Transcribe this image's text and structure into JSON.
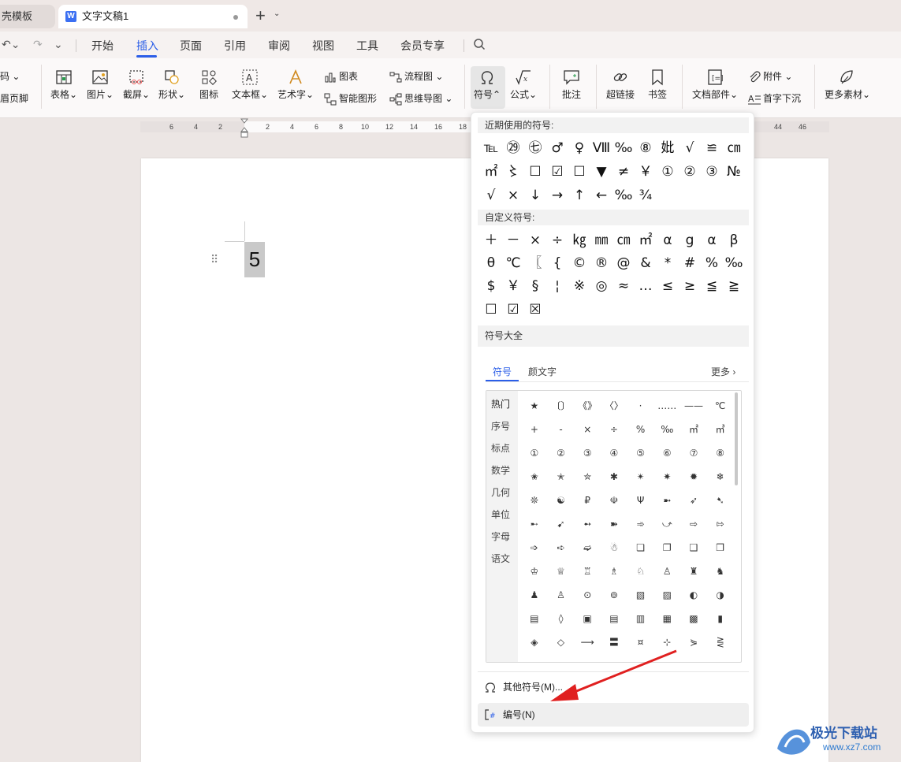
{
  "tabs": {
    "prev_label": "壳模板",
    "active_label": "文字文稿1",
    "app_logo": "W"
  },
  "menu": {
    "items": [
      "开始",
      "插入",
      "页面",
      "引用",
      "审阅",
      "视图",
      "工具",
      "会员专享"
    ],
    "active": "插入"
  },
  "ribbon": {
    "left_partial_top": "码",
    "left_partial_bottom": "眉页脚",
    "table": "表格",
    "picture": "图片",
    "screenshot": "截屏",
    "shape": "形状",
    "icon": "图标",
    "textbox": "文本框",
    "wordart": "艺术字",
    "chart": "图表",
    "smartart": "智能图形",
    "flowchart": "流程图",
    "mindmap": "思维导图",
    "symbol": "符号",
    "formula": "公式",
    "comment": "批注",
    "hyperlink": "超链接",
    "bookmark": "书签",
    "docparts": "文档部件",
    "attachment": "附件",
    "dropcap": "首字下沉",
    "more_assets": "更多素材"
  },
  "ruler": {
    "numbers": [
      "6",
      "4",
      "2",
      "2",
      "4",
      "6",
      "8",
      "10",
      "12",
      "14",
      "16",
      "18",
      "44",
      "46"
    ]
  },
  "document": {
    "selected_text": "5"
  },
  "symbol_panel": {
    "recent_title": "近期使用的符号:",
    "recent_rows": [
      [
        "℡",
        "㉙",
        "㊆",
        "♂",
        "♀",
        "Ⅷ",
        "‰",
        "⑧",
        "妣",
        "√",
        "≌",
        "㎝"
      ],
      [
        "㎡",
        "〻",
        "☐",
        "☑",
        "☐",
        "▼",
        "≠",
        "￥",
        "①",
        "②",
        "③",
        "№"
      ],
      [
        "√",
        "×",
        "↓",
        "→",
        "↑",
        "←",
        "‰",
        "¾"
      ]
    ],
    "custom_title": "自定义符号:",
    "custom_rows": [
      [
        "＋",
        "－",
        "×",
        "÷",
        "㎏",
        "㎜",
        "㎝",
        "㎡",
        "α",
        "g",
        "α",
        "β"
      ],
      [
        "θ",
        "℃",
        "〖",
        "{",
        "©",
        "®",
        "@",
        "&",
        "*",
        "#",
        "%",
        "‰"
      ],
      [
        "$",
        "￥",
        "§",
        "¦",
        "※",
        "◎",
        "≈",
        "…",
        "≤",
        "≥",
        "≦",
        "≧"
      ],
      [
        "☐",
        "☑",
        "☒"
      ]
    ],
    "all_title": "符号大全",
    "sub_tabs": [
      "符号",
      "颜文字"
    ],
    "active_sub_tab": "符号",
    "more_label": "更多 ›",
    "categories": [
      "热门",
      "序号",
      "标点",
      "数学",
      "几何",
      "单位",
      "字母",
      "语文"
    ],
    "active_category": "热门",
    "grid_rows": [
      [
        "★",
        "〔〕",
        "《》",
        "〈〉",
        "·",
        "……",
        "——",
        "℃"
      ],
      [
        "+",
        "-",
        "×",
        "÷",
        "%",
        "‰",
        "㎡",
        "㎥"
      ],
      [
        "①",
        "②",
        "③",
        "④",
        "⑤",
        "⑥",
        "⑦",
        "⑧"
      ],
      [
        "✬",
        "✭",
        "✮",
        "✱",
        "✴",
        "✷",
        "✹",
        "❄"
      ],
      [
        "❊",
        "☯",
        "₽",
        "☫",
        "Ψ",
        "➼",
        "➶",
        "➷"
      ],
      [
        "➸",
        "➹",
        "➻",
        "➽",
        "➾",
        "⤻",
        "⇨",
        "⇰"
      ],
      [
        "➩",
        "➪",
        "➫",
        "☃",
        "❏",
        "❐",
        "❑",
        "❒"
      ],
      [
        "♔",
        "♕",
        "♖",
        "♗",
        "♘",
        "♙",
        "♜",
        "♞"
      ],
      [
        "♟",
        "♙",
        "⊙",
        "⊚",
        "▧",
        "▨",
        "◐",
        "◑"
      ],
      [
        "▤",
        "◊",
        "▣",
        "▤",
        "▥",
        "▦",
        "▩",
        "▮"
      ],
      [
        "◈",
        "◇",
        "⟶",
        "〓",
        "¤",
        "⊹",
        "⋟",
        "⋛"
      ]
    ],
    "other_symbols": "其他符号(M)...",
    "numbering": "编号(N)"
  },
  "watermark": {
    "title": "极光下载站",
    "url": "www.xz7.com"
  },
  "colors": {
    "accent": "#2b5ee8",
    "annotation_arrow": "#e02020"
  }
}
